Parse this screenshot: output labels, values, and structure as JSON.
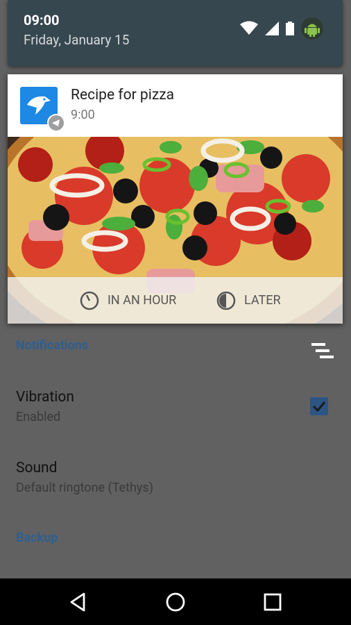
{
  "status": {
    "time": "09:00",
    "date": "Friday, January 15"
  },
  "notification": {
    "title": "Recipe for pizza",
    "time": "9:00",
    "actions": [
      {
        "label": "IN AN HOUR",
        "icon": "clock-icon"
      },
      {
        "label": "LATER",
        "icon": "half-moon-clock-icon"
      }
    ]
  },
  "settings": {
    "notifications_header": "Notifications",
    "vibration": {
      "title": "Vibration",
      "summary": "Enabled",
      "checked": true
    },
    "sound": {
      "title": "Sound",
      "summary": "Default ringtone (Tethys)"
    },
    "backup_header": "Backup"
  },
  "colors": {
    "accent": "#2c5584",
    "panel": "#37474f",
    "app_icon": "#1e88e5"
  }
}
